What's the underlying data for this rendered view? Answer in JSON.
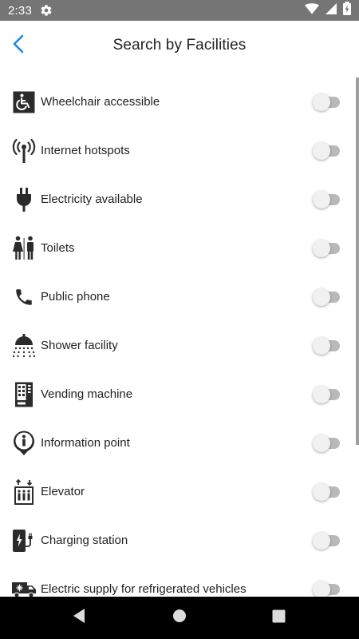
{
  "status_bar": {
    "time": "2:33",
    "icons": [
      "settings-gear-icon",
      "wifi-icon",
      "cell-signal-icon",
      "battery-charging-icon"
    ]
  },
  "header": {
    "title": "Search by Facilities",
    "back_icon": "chevron-left-icon",
    "accent_color": "#1E88E5"
  },
  "facilities": [
    {
      "label": "Wheelchair accessible",
      "icon": "wheelchair-icon",
      "enabled": false
    },
    {
      "label": "Internet hotspots",
      "icon": "hotspot-antenna-icon",
      "enabled": false
    },
    {
      "label": "Electricity available",
      "icon": "electric-plug-icon",
      "enabled": false
    },
    {
      "label": "Toilets",
      "icon": "toilets-icon",
      "enabled": false
    },
    {
      "label": "Public phone",
      "icon": "phone-icon",
      "enabled": false
    },
    {
      "label": "Shower facility",
      "icon": "shower-icon",
      "enabled": false
    },
    {
      "label": "Vending machine",
      "icon": "vending-machine-icon",
      "enabled": false
    },
    {
      "label": "Information point",
      "icon": "information-icon",
      "enabled": false
    },
    {
      "label": "Elevator",
      "icon": "elevator-icon",
      "enabled": false
    },
    {
      "label": "Charging station",
      "icon": "charging-station-icon",
      "enabled": false
    },
    {
      "label": "Electric supply for refrigerated vehicles",
      "icon": "refrigerated-truck-icon",
      "enabled": false
    }
  ],
  "nav_bar": {
    "icons": [
      "nav-back-icon",
      "nav-home-icon",
      "nav-recents-icon"
    ]
  }
}
